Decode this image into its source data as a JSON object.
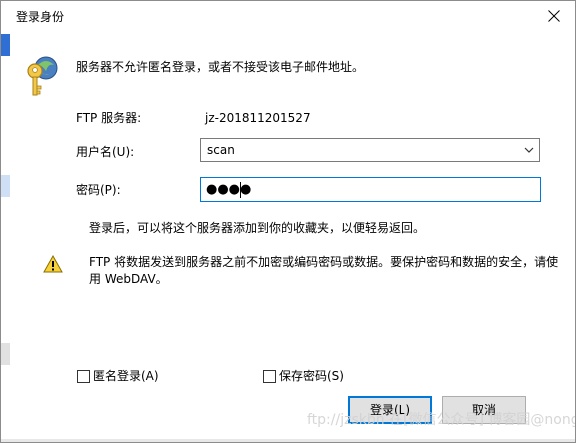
{
  "window": {
    "title": "登录身份",
    "close_icon": "close-icon"
  },
  "info": {
    "message": "服务器不允许匿名登录，或者不接受该电子邮件地址。",
    "icon": "key-icon"
  },
  "form": {
    "ftp_server_label": "FTP 服务器:",
    "ftp_server_value": "jz-201811201527",
    "username_label": "用户名(U):",
    "username_value": "scan",
    "password_label": "密码(P):",
    "password_mask": "●●●●"
  },
  "hint": "登录后，可以将这个服务器添加到你的收藏夹，以便轻易返回。",
  "warning": {
    "icon": "warning-icon",
    "text": "FTP 将数据发送到服务器之前不加密或编码密码或数据。要保护密码和数据的安全，请使用 WebDAV。"
  },
  "options": {
    "anonymous_label": "匿名登录(A)",
    "save_password_label": "保存密码(S)"
  },
  "buttons": {
    "login": "登录(L)",
    "cancel": "取消"
  },
  "watermark": "ftp://jzskbn 在[微信公众号] 博客园@nongliang",
  "colors": {
    "accent": "#0078d7",
    "button_bg": "#e1e1e1",
    "warning_yellow": "#f6d13a"
  }
}
